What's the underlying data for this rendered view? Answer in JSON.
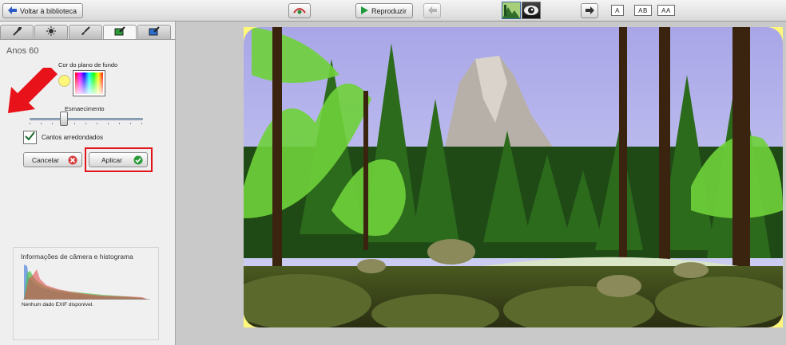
{
  "toolbar": {
    "back_label": "Voltar à biblioteca",
    "play_label": "Reproduzir",
    "size_buttons": [
      "A",
      "AB",
      "AA"
    ]
  },
  "panel": {
    "tabs": [
      "wrench-icon",
      "sun-adjust-icon",
      "brush-icon",
      "effects-icon",
      "paint-effects-icon"
    ],
    "active_tab": 3,
    "effect_title": "Anos 60",
    "bg_color_label": "Cor do plano de fundo",
    "bg_color": "#fff77a",
    "fade_label": "Esmaecimento",
    "fade_value": 0.3,
    "rounded_label": "Cantos arredondados",
    "rounded_checked": true,
    "cancel_label": "Cancelar",
    "apply_label": "Aplicar"
  },
  "exif": {
    "title": "Informações de câmera e histograma",
    "note": "Nenhum dado EXIF disponível."
  },
  "colors": {
    "highlight": "#e0141a",
    "photo_border": "#fff77a",
    "cancel_icon": "#d83a3a",
    "apply_icon": "#2a9a3a"
  }
}
